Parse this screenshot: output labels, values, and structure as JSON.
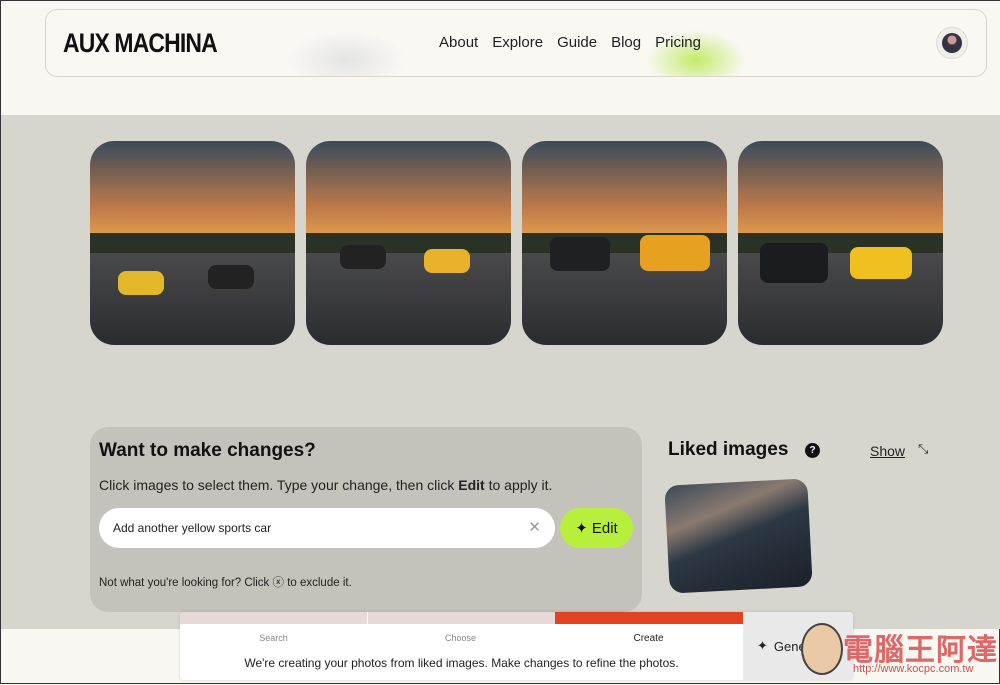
{
  "header": {
    "logo": "AUX MACHINA",
    "nav": [
      "About",
      "Explore",
      "Guide",
      "Blog",
      "Pricing"
    ]
  },
  "gallery": {
    "images": [
      "sunset-road-yellow-and-black-cars",
      "sunset-highway-black-and-yellow-cars",
      "sunset-road-black-and-orange-cars",
      "sunset-road-black-mustang-and-yellow-lamborghini"
    ]
  },
  "changes": {
    "title": "Want to make changes?",
    "desc_prefix": "Click images to select them. Type your change, then click ",
    "desc_bold": "Edit",
    "desc_suffix": " to apply it.",
    "input_value": "Add another yellow sports car",
    "edit_label": "Edit",
    "hint_prefix": "Not what you're looking for? Click ",
    "hint_suffix": " to exclude it."
  },
  "liked": {
    "title": "Liked images",
    "show_label": "Show"
  },
  "progress": {
    "steps": [
      "Search",
      "Choose",
      "Create"
    ],
    "active": "Create",
    "status": "We're creating your photos from liked images. Make changes to refine the photos.",
    "generate_label": "Generate",
    "colors": {
      "done": "#e8d8d8",
      "active": "#e0441e"
    }
  },
  "watermark": {
    "text": "電腦王阿達",
    "url": "http://www.kocpc.com.tw"
  }
}
